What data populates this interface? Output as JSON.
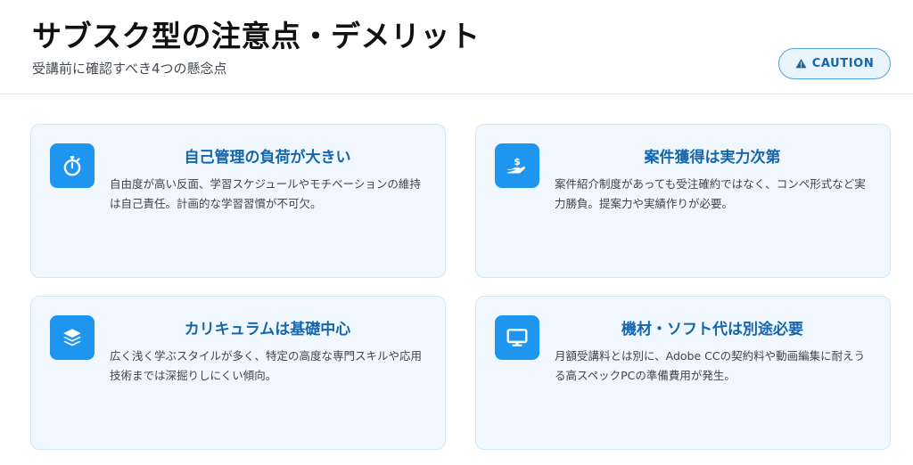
{
  "header": {
    "title": "サブスク型の注意点・デメリット",
    "subtitle": "受講前に確認すべき4つの懸念点",
    "badge": {
      "label": "CAUTION",
      "icon": "warning-icon",
      "color": "#1565a8"
    }
  },
  "cards": [
    {
      "icon": "stopwatch-icon",
      "title": "自己管理の負荷が大きい",
      "body": "自由度が高い反面、学習スケジュールやモチベーションの維持は自己責任。計画的な学習習慣が不可欠。"
    },
    {
      "icon": "hand-holding-dollar-icon",
      "title": "案件獲得は実力次第",
      "body": "案件紹介制度があっても受注確約ではなく、コンペ形式など実力勝負。提案力や実績作りが必要。"
    },
    {
      "icon": "layers-icon",
      "title": "カリキュラムは基礎中心",
      "body": "広く浅く学ぶスタイルが多く、特定の高度な専門スキルや応用技術までは深掘りしにくい傾向。"
    },
    {
      "icon": "monitor-icon",
      "title": "機材・ソフト代は別途必要",
      "body": "月額受講料とは別に、Adobe CCの契約料や動画編集に耐えうる高スペックPCの準備費用が発生。"
    }
  ],
  "colors": {
    "accent": "#1e96f0",
    "card_title": "#1566ad",
    "card_bg": "#f0f7fe",
    "card_border": "#d3e6f8"
  }
}
